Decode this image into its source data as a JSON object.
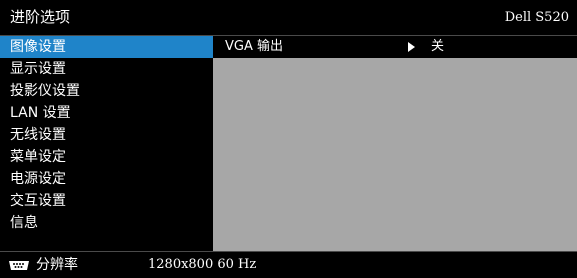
{
  "header": {
    "title": "进阶选项",
    "model": "Dell S520"
  },
  "menu": {
    "items": [
      {
        "label": "图像设置"
      },
      {
        "label": "显示设置"
      },
      {
        "label": "投影仪设置"
      },
      {
        "label": "LAN 设置"
      },
      {
        "label": "无线设置"
      },
      {
        "label": "菜单设定"
      },
      {
        "label": "电源设定"
      },
      {
        "label": "交互设置"
      },
      {
        "label": "信息"
      }
    ],
    "selected_index": 0
  },
  "panel": {
    "option_label": "VGA 输出",
    "option_value": "关"
  },
  "footer": {
    "label": "分辨率",
    "value": "1280x800 60 Hz"
  },
  "colors": {
    "highlight": "#1f84c9",
    "panel_bg": "#a7a7a7",
    "background": "#000000",
    "text": "#ffffff"
  },
  "icons": {
    "option_arrow": "triangle-right-icon",
    "input_source": "input-source-icon"
  }
}
